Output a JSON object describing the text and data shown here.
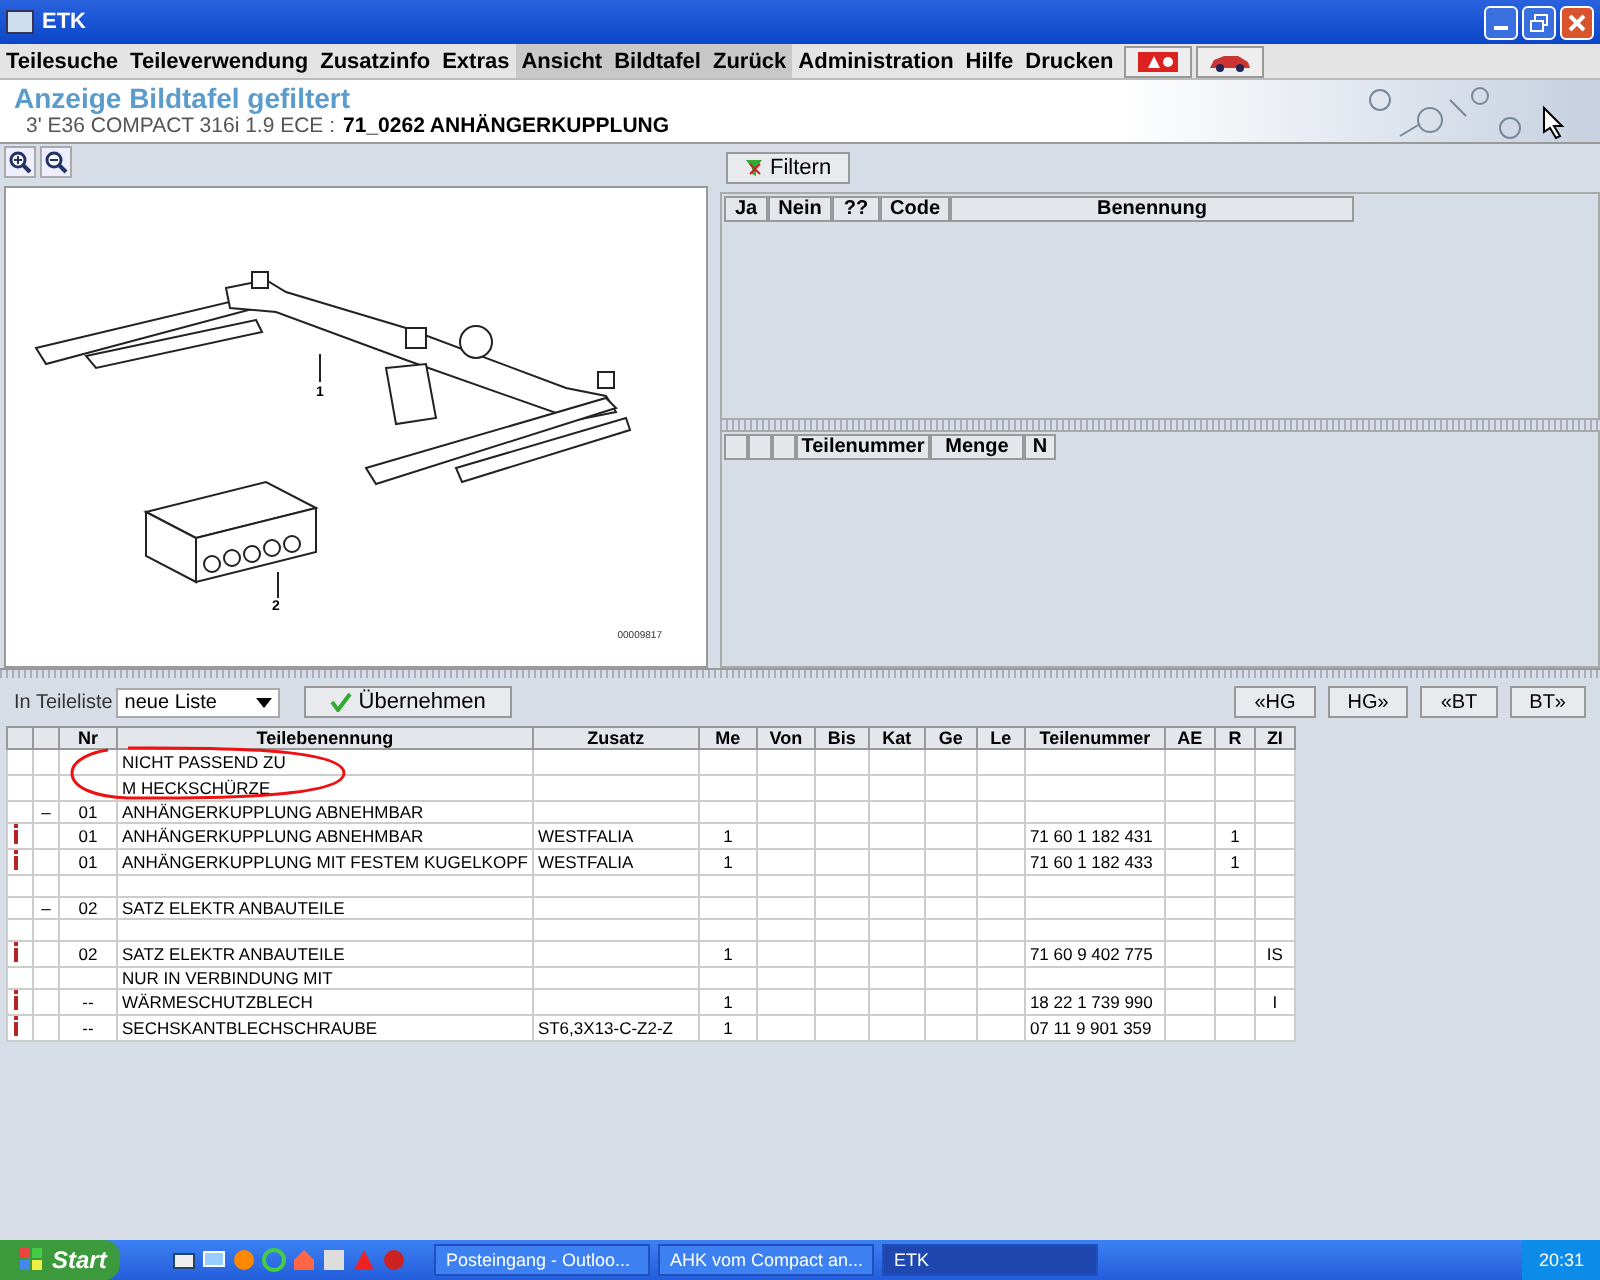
{
  "window": {
    "title": "ETK"
  },
  "menu": [
    {
      "label": "Teilesuche",
      "active": false
    },
    {
      "label": "Teileverwendung",
      "active": false
    },
    {
      "label": "Zusatzinfo",
      "active": false
    },
    {
      "label": "Extras",
      "active": false
    },
    {
      "label": "Ansicht",
      "active": true
    },
    {
      "label": "Bildtafel",
      "active": true
    },
    {
      "label": "Zurück",
      "active": true
    },
    {
      "label": "Administration",
      "active": false
    },
    {
      "label": "Hilfe",
      "active": false
    },
    {
      "label": "Drucken",
      "active": false
    }
  ],
  "header": {
    "title": "Anzeige Bildtafel gefiltert",
    "model": "3' E36 COMPACT 316i 1.9 ECE :",
    "group": "71_0262 ANHÄNGERKUPPLUNG"
  },
  "illustration": {
    "callouts": [
      "1",
      "2"
    ],
    "code": "00009817"
  },
  "filter": {
    "button": "Filtern",
    "columns": [
      "Ja",
      "Nein",
      "??",
      "Code",
      "Benennung"
    ]
  },
  "parts_pane": {
    "columns": [
      "Teilenummer",
      "Menge",
      "N"
    ]
  },
  "list_bar": {
    "label": "In Teileliste",
    "dropdown": "neue Liste",
    "apply": "Übernehmen",
    "nav": [
      "«HG",
      "HG»",
      "«BT",
      "BT»"
    ]
  },
  "table": {
    "columns": [
      "Nr",
      "Teilebenennung",
      "Zusatz",
      "Me",
      "Von",
      "Bis",
      "Kat",
      "Ge",
      "Le",
      "Teilenummer",
      "AE",
      "R",
      "ZI"
    ],
    "rows": [
      {
        "info": false,
        "name": "NICHT PASSEND ZU"
      },
      {
        "info": false,
        "name": "M HECKSCHÜRZE"
      },
      {
        "info": false,
        "expander": "–",
        "nr": "01",
        "name": "ANHÄNGERKUPPLUNG ABNEHMBAR"
      },
      {
        "info": true,
        "nr": "01",
        "name": "ANHÄNGERKUPPLUNG ABNEHMBAR",
        "zusatz": "WESTFALIA",
        "me": "1",
        "teilenummer": "71 60 1 182 431",
        "r": "1"
      },
      {
        "info": true,
        "nr": "01",
        "name": "ANHÄNGERKUPPLUNG MIT FESTEM KUGELKOPF",
        "zusatz": "WESTFALIA",
        "me": "1",
        "teilenummer": "71 60 1 182 433",
        "r": "1"
      },
      {
        "info": false
      },
      {
        "info": false,
        "expander": "–",
        "nr": "02",
        "name": "SATZ ELEKTR ANBAUTEILE"
      },
      {
        "info": false
      },
      {
        "info": true,
        "nr": "02",
        "name": "SATZ ELEKTR ANBAUTEILE",
        "me": "1",
        "teilenummer": "71 60 9 402 775",
        "zi": "IS"
      },
      {
        "info": false,
        "name": "NUR IN VERBINDUNG MIT"
      },
      {
        "info": true,
        "nr": "--",
        "name": "WÄRMESCHUTZBLECH",
        "me": "1",
        "teilenummer": "18 22 1 739 990",
        "zi": "I"
      },
      {
        "info": true,
        "nr": "--",
        "name": "SECHSKANTBLECHSCHRAUBE",
        "zusatz": "ST6,3X13-C-Z2-Z",
        "me": "1",
        "teilenummer": "07 11 9 901 359"
      }
    ]
  },
  "taskbar": {
    "start": "Start",
    "tasks": [
      {
        "label": "Posteingang - Outloo...",
        "selected": false
      },
      {
        "label": "AHK vom Compact an...",
        "selected": false
      },
      {
        "label": "ETK",
        "selected": true
      }
    ],
    "clock": "20:31"
  }
}
